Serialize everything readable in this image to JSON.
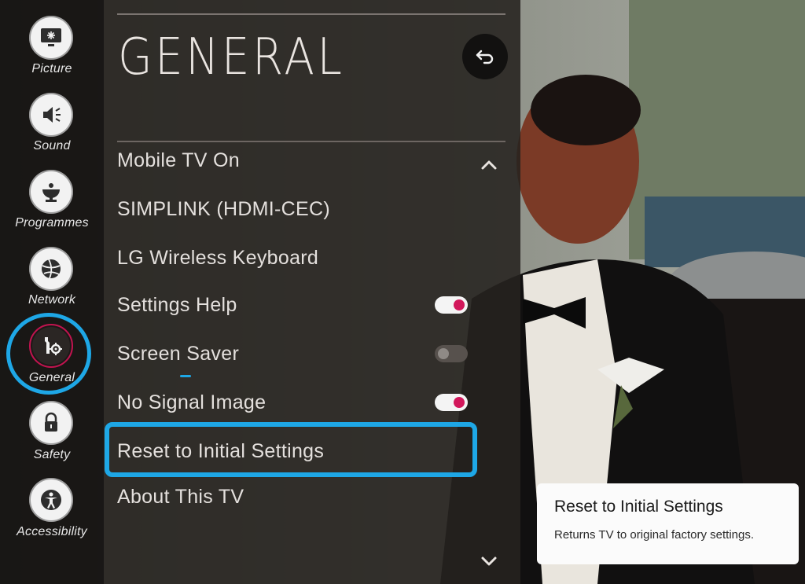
{
  "sidebar": {
    "items": [
      {
        "label": "Picture",
        "icon": "picture-icon"
      },
      {
        "label": "Sound",
        "icon": "speaker-icon"
      },
      {
        "label": "Programmes",
        "icon": "satellite-dish-icon"
      },
      {
        "label": "Network",
        "icon": "globe-icon"
      },
      {
        "label": "General",
        "icon": "wrench-gear-icon",
        "active": true
      },
      {
        "label": "Safety",
        "icon": "lock-icon"
      },
      {
        "label": "Accessibility",
        "icon": "accessibility-icon"
      }
    ]
  },
  "panel": {
    "title": "GENERAL",
    "items": [
      {
        "label": "Mobile TV On"
      },
      {
        "label": "SIMPLINK (HDMI-CEC)"
      },
      {
        "label": "LG Wireless Keyboard"
      },
      {
        "label": "Settings Help",
        "toggle": "on"
      },
      {
        "label": "Screen Saver",
        "toggle": "off"
      },
      {
        "label": "No Signal Image",
        "toggle": "on"
      },
      {
        "label": "Reset to Initial Settings",
        "selected": true
      },
      {
        "label": "About This TV"
      }
    ]
  },
  "tooltip": {
    "title": "Reset to Initial Settings",
    "description": "Returns TV to original factory settings."
  },
  "colors": {
    "accent": "#c2134f",
    "toggle_knob_on": "#d2175b",
    "annotation": "#1ea7e6"
  }
}
